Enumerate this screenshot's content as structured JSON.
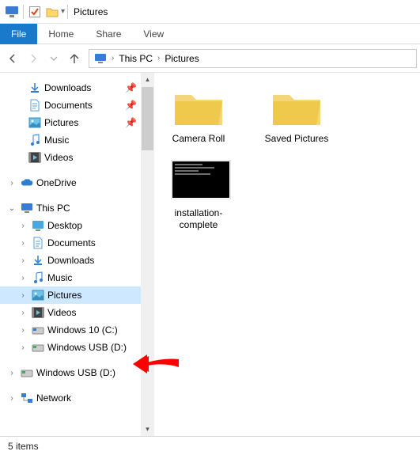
{
  "titlebar": {
    "title": "Pictures"
  },
  "ribbon": {
    "file": "File",
    "home": "Home",
    "share": "Share",
    "view": "View"
  },
  "address": {
    "seg1": "This PC",
    "seg2": "Pictures"
  },
  "tree": {
    "downloads": "Downloads",
    "documents": "Documents",
    "pictures": "Pictures",
    "music": "Music",
    "videos": "Videos",
    "onedrive": "OneDrive",
    "thispc": "This PC",
    "desktop": "Desktop",
    "documents2": "Documents",
    "downloads2": "Downloads",
    "music2": "Music",
    "pictures2": "Pictures",
    "videos2": "Videos",
    "win10": "Windows 10 (C:)",
    "winusb": "Windows USB (D:)",
    "winusb2": "Windows USB (D:)",
    "network": "Network"
  },
  "content": {
    "cameraroll": "Camera Roll",
    "savedpictures": "Saved Pictures",
    "installation": "installation-complete"
  },
  "status": {
    "text": "5 items"
  }
}
